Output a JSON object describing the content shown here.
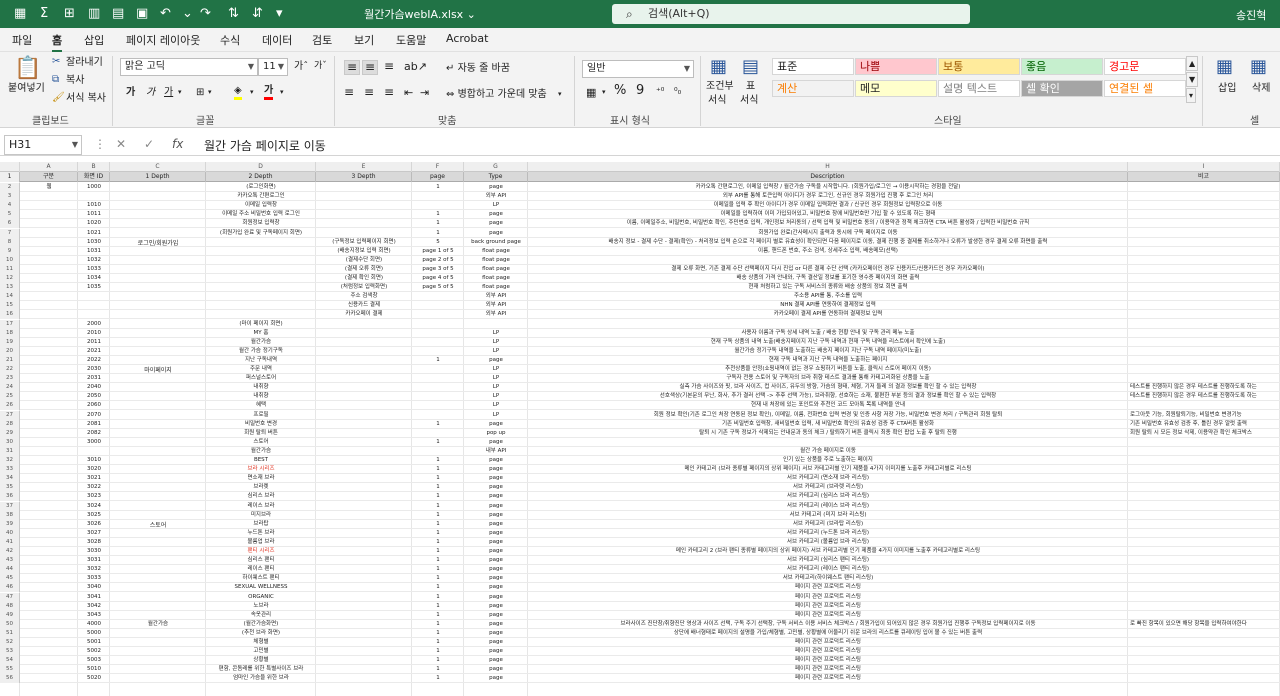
{
  "titlebar": {
    "filename": "월간가슴webIA.xlsx ⌄",
    "search": "검색(Alt+Q)",
    "user": "송진혁"
  },
  "menu": [
    "파일",
    "홈",
    "삽입",
    "페이지 레이아웃",
    "수식",
    "데이터",
    "검토",
    "보기",
    "도움말",
    "Acrobat"
  ],
  "ribbon": {
    "paste": "붙여넣기",
    "cut": "잘라내기",
    "copy": "복사",
    "format_painter": "서식 복사",
    "clipboard": "클립보드",
    "font_name": "맑은 고딕",
    "font_size": "11",
    "font_group": "글꼴",
    "wrap": "자동 줄 바꿈",
    "merge": "병합하고 가운데 맞춤",
    "align_group": "맞춤",
    "num_format": "일반",
    "num_group": "표시 형식",
    "cond_format": "조건부",
    "cond_format2": "서식",
    "table_format": "표",
    "table_format2": "서식",
    "styles": [
      {
        "label": "표준",
        "bg": "#ffffff",
        "color": "#222"
      },
      {
        "label": "나쁨",
        "bg": "#ffc7ce",
        "color": "#9c0006"
      },
      {
        "label": "보통",
        "bg": "#ffeb9c",
        "color": "#9c5700"
      },
      {
        "label": "좋음",
        "bg": "#c6efce",
        "color": "#006100"
      },
      {
        "label": "경고문",
        "bg": "#ffffff",
        "color": "#ff0000"
      },
      {
        "label": "계산",
        "bg": "#f2f2f2",
        "color": "#fa7d00"
      },
      {
        "label": "메모",
        "bg": "#ffffcc",
        "color": "#222"
      },
      {
        "label": "설명 텍스트",
        "bg": "#ffffff",
        "color": "#7f7f7f"
      },
      {
        "label": "셀 확인",
        "bg": "#a5a5a5",
        "color": "#ffffff"
      },
      {
        "label": "연결된 셀",
        "bg": "#ffffff",
        "color": "#fa7d00"
      }
    ],
    "style_group": "스타일",
    "insert": "삽입",
    "delete": "삭제",
    "cells_group": "셀"
  },
  "formula": {
    "cellref": "H31",
    "fx": "fx",
    "content": "월간 가슴 페이지로 이동"
  },
  "colletters": [
    "A",
    "B",
    "C",
    "D",
    "E",
    "F",
    "G",
    "H",
    "I"
  ],
  "headers": [
    "구분",
    "화면 ID",
    "1 Depth",
    "2 Depth",
    "3 Depth",
    "page",
    "Type",
    "Description",
    "비고"
  ],
  "rows": [
    {
      "n": "2",
      "a": "웹",
      "b": "1000",
      "c": "",
      "d": "(로그인화면)",
      "e": "",
      "f": "1",
      "g": "page",
      "h": "카카오톡 간편로그인, 이메일 입력창 / 월간가슴 구독을 시작합니다. (회원가입/로그인 → 이용시작하는 경험을 전달)",
      "i": ""
    },
    {
      "n": "3",
      "a": "",
      "b": "",
      "c": "",
      "d": "카카오톡 간편로그인",
      "e": "",
      "f": "",
      "g": "외부 API",
      "h": "외부 API를 통해 토큰입력 아이디가 경우 로그인, 신규인 경우 회원가입 진행 후 로그인 처리",
      "i": ""
    },
    {
      "n": "4",
      "a": "",
      "b": "1010",
      "c": "",
      "d": "이메일 입력창",
      "e": "",
      "f": "",
      "g": "LP",
      "h": "이메일을 입력 후 확인 아이디가 경우 이메일 입력화면 결과 / 신규인 경우 회원정보 입력창으로 이동",
      "i": ""
    },
    {
      "n": "5",
      "a": "",
      "b": "1011",
      "c": "",
      "d": "이메일 주소 비밀번호 입력 로그인",
      "e": "",
      "f": "1",
      "g": "page",
      "h": "이메일을 입력하여 이미 가입되어있고, 비밀번호 창에 비밀번호만 기입 할 수 있도록 하는 형태",
      "i": ""
    },
    {
      "n": "6",
      "a": "",
      "b": "1020",
      "c": "",
      "d": "회원정보 입력창",
      "e": "",
      "f": "1",
      "g": "page",
      "h": "이름, 이메일주소, 비밀번호, 비밀번호 확인, 주민번호 입력, 개인정보 처리동의 / 선택 입력 및 비밀번호 동의 / 이용약관 정책 체크하면 CTA 버튼 활성화 / 입력한 비밀번호 규칙",
      "i": ""
    },
    {
      "n": "7",
      "a": "",
      "b": "1021",
      "c": "",
      "d": "(회원가입 완료 및 구독페이지 회면)",
      "e": "",
      "f": "1",
      "g": "page",
      "h": "회원가입 완료(간사메시지 출력과 동시에 구독 페이지로 이동",
      "i": ""
    },
    {
      "n": "8",
      "a": "",
      "b": "1030",
      "c": "",
      "d": "",
      "e": "(구독정보 입력페이지 회면)",
      "f": "5",
      "g": "back ground page",
      "h": "배송지 정보 - 결제 수단 - 결제(확인) - 처리정보 입력 순으로 각 페이지 별로 유효성이 확인되면 다음 페이지로 이동, 결제 진행 중 결제를 취소하거나 오류가 발생한 경우 결제 오류 화면을 출력",
      "i": ""
    },
    {
      "n": "9",
      "a": "",
      "b": "1031",
      "c": "",
      "d": "",
      "e": "(배송지정보 입력 회면)",
      "f": "page 1 of 5",
      "g": "float page",
      "h": "이름, 핸드폰 번호, 주소 검색, 상세주소 입력, 배송메모(선택)",
      "i": ""
    },
    {
      "n": "10",
      "a": "",
      "b": "1032",
      "c": "",
      "d": "",
      "e": "(결제수단 회면)",
      "f": "page 2 of 5",
      "g": "float page",
      "h": "",
      "i": ""
    },
    {
      "n": "11",
      "a": "",
      "b": "1033",
      "c": "",
      "d": "",
      "e": "(결제 오류 회면)",
      "f": "page 3 of 5",
      "g": "float page",
      "h": "결제 오류 화면, 기존 결제 수단 선택페이지 다시 진입 or 다른 결제 수단 선택 (카카오페이인 경우 신용카드/신용카드인 경우 카카오페이)",
      "i": ""
    },
    {
      "n": "12",
      "a": "",
      "b": "1034",
      "c": "",
      "d": "",
      "e": "(결제 확인 회면)",
      "f": "page 4 of 5",
      "g": "float page",
      "h": "배송 상품의 가격 안내와, 구독 결산일 정보를 표기한 영수증 페이지의 화면 출력",
      "i": ""
    },
    {
      "n": "13",
      "a": "",
      "b": "1035",
      "c": "",
      "d": "",
      "e": "(처럼정보 입력화면)",
      "f": "page 5 of 5",
      "g": "float page",
      "h": "현재 처럼하고 있는 구독 서비스의 종류와 배송 상품의 정보 회면 출력",
      "i": ""
    },
    {
      "n": "14",
      "a": "",
      "b": "",
      "c": "",
      "d": "",
      "e": "주소 검색창",
      "f": "",
      "g": "외부 API",
      "h": "주소용 API를 통, 주소를 입력",
      "i": ""
    },
    {
      "n": "15",
      "a": "",
      "b": "",
      "c": "",
      "d": "",
      "e": "신용카드 결제",
      "f": "",
      "g": "외부 API",
      "h": "NHN 결제 API를 연동하여 결제정보 입력",
      "i": ""
    },
    {
      "n": "16",
      "a": "",
      "b": "",
      "c": "",
      "d": "",
      "e": "카카오페이 결제",
      "f": "",
      "g": "외부 API",
      "h": "카카오페이 결제 API를 연동하여 결제정보 입력",
      "i": ""
    },
    {
      "n": "17",
      "a": "",
      "b": "2000",
      "c": "",
      "d": "(마이 페이지 회면)",
      "e": "",
      "f": "",
      "g": "",
      "h": "",
      "i": ""
    },
    {
      "n": "18",
      "a": "",
      "b": "2010",
      "c": "",
      "d": "MY 홈",
      "e": "",
      "f": "",
      "g": "LP",
      "h": "사용자 이름과 구독 상세 내역 노출 / 배송 현황 안내 및 구독 관리 메뉴 노출",
      "i": ""
    },
    {
      "n": "19",
      "a": "",
      "b": "2011",
      "c": "",
      "d": "월간가슴",
      "e": "",
      "f": "",
      "g": "LP",
      "h": "현재 구독 상품의 내역 노출(배송지페이지 지난 구독 내역과 현재 구독 내역을 리스트에서 확인에 노출)",
      "i": ""
    },
    {
      "n": "20",
      "a": "",
      "b": "2021",
      "c": "",
      "d": "월간 가슴 정기구독",
      "e": "",
      "f": "",
      "g": "LP",
      "h": "월간가슴 정기구독 내역을 노출하는 배송지 페이지 지난 구독 내역 페이지(미노출)",
      "i": ""
    },
    {
      "n": "21",
      "a": "",
      "b": "2022",
      "c": "",
      "d": "지난 구독내역",
      "e": "",
      "f": "1",
      "g": "page",
      "h": "현재 구독 내역과 지난 구독 내역을 노출하는 페이지",
      "i": ""
    },
    {
      "n": "22",
      "a": "",
      "b": "2030",
      "c": "",
      "d": "주문 내역",
      "e": "",
      "f": "",
      "g": "LP",
      "h": "추천상품을 안정(쇼핑내역이 없는 경우 쇼핑하기 버튼을 노출, 클릭시 스토어 페이지 이동)",
      "i": ""
    },
    {
      "n": "23",
      "a": "",
      "b": "2031",
      "c": "",
      "d": "퍼스널스토어",
      "e": "",
      "f": "",
      "g": "LP",
      "h": "구독자 전용 스토어 및 구독자의 브라 취향 테스트 결과를 통해 카테고리화된 상품을 노출",
      "i": ""
    },
    {
      "n": "24",
      "a": "",
      "b": "2040",
      "c": "",
      "d": "내취향",
      "e": "",
      "f": "",
      "g": "LP",
      "h": "실측 가슴 사이즈와 핏, 브라 사이즈, 컵 사이즈, 유두의 방향, 가슴의 형태, 체형, 기저 둘레 의 결과 정보를 확인 할 수 있는 입력창",
      "i": "테스트를 진행하지 않은 경우 테스트를 진행하도록 하는"
    },
    {
      "n": "25",
      "a": "",
      "b": "2050",
      "c": "",
      "d": "내취향",
      "e": "",
      "f": "",
      "g": "LP",
      "h": "선호색상(기본문의 무난, 화사, 추가 결러 선택 -> 추후 선택 가능), 브라취향, 선호하는 소재, 불편한 부분 등의 결과 정보를 확인 할 수 있는 입력창",
      "i": "테스트를 진행하지 않은 경우 테스트를 진행하도록 하는"
    },
    {
      "n": "26",
      "a": "",
      "b": "2060",
      "c": "",
      "d": "혜택",
      "e": "",
      "f": "",
      "g": "LP",
      "h": "현재 내 처장에 있는 포인트와 추천인 코드 모아톡 목록 내역을 안내",
      "i": ""
    },
    {
      "n": "27",
      "a": "",
      "b": "2070",
      "c": "",
      "d": "프로필",
      "e": "",
      "f": "",
      "g": "LP",
      "h": "회원 정보 확인(기존 로그인 처장 연동된 정보 확인), 이메일, 이름, 전화번호 입력 변경 및 인증 사항 저장 가능, 비밀번호 변경 처리 / 구독관리 회원 탈퇴",
      "i": "로그아웃 기능, 회원탈퇴기능, 비밀번호 변경기능"
    },
    {
      "n": "28",
      "a": "",
      "b": "2081",
      "c": "",
      "d": "비밀번호 변경",
      "e": "",
      "f": "1",
      "g": "page",
      "h": "기존 비밀번호 입력창, 새비밀번호 입력, 새 비밀번호 확인의 유효성 검증 후 CTA버튼 활성화",
      "i": "기존 비밀번호 유효성 검증 후, 틀린 경우 알럿 출력"
    },
    {
      "n": "29",
      "a": "",
      "b": "2082",
      "c": "",
      "d": "회원 탈퇴 버튼",
      "e": "",
      "f": "",
      "g": "pop up",
      "h": "탈퇴 시 기존 구독 정보가 삭제되는 안내문과 동의 체크 / 탈퇴하기 버튼 클릭시 최종 확인 팝업 노출 후 탈퇴 진행",
      "i": "회원 탈퇴 시 모든 정보 삭제, 이용약관 확인 체크박스"
    },
    {
      "n": "30",
      "a": "",
      "b": "3000",
      "c": "",
      "d": "스토어",
      "e": "",
      "f": "1",
      "g": "page",
      "h": "",
      "i": ""
    },
    {
      "n": "31",
      "a": "",
      "b": "",
      "c": "",
      "d": "월간가슴",
      "e": "",
      "f": "",
      "g": "내부 API",
      "h": "월간 가슴 페이지로 이동",
      "i": ""
    },
    {
      "n": "32",
      "a": "",
      "b": "3010",
      "c": "",
      "d": "BEST",
      "e": "",
      "f": "1",
      "g": "page",
      "h": "인기 있는 상품을 주로 노출하는 페이지",
      "i": ""
    },
    {
      "n": "33",
      "a": "",
      "b": "3020",
      "c": "",
      "d": "브라 시리즈",
      "e": "",
      "f": "1",
      "g": "page",
      "h": "메인 카테고리 (브라 종류별 페이지의 상위 페이지) 서브 카테고리별 인기 제품을 4가지 이미지를 노출후 카테고리별로 리스팅",
      "i": "",
      "red": true
    },
    {
      "n": "34",
      "a": "",
      "b": "3021",
      "c": "",
      "d": "면소재 브라",
      "e": "",
      "f": "1",
      "g": "page",
      "h": "서브 카테고리 (면소재 브라 리스팅)",
      "i": ""
    },
    {
      "n": "35",
      "a": "",
      "b": "3022",
      "c": "",
      "d": "브라렛",
      "e": "",
      "f": "1",
      "g": "page",
      "h": "서브 카테고리 (브라렛 리스팅)",
      "i": ""
    },
    {
      "n": "36",
      "a": "",
      "b": "3023",
      "c": "",
      "d": "심리스 브라",
      "e": "",
      "f": "1",
      "g": "page",
      "h": "서브 카테고리 (심리스 브라 리스팅)",
      "i": ""
    },
    {
      "n": "37",
      "a": "",
      "b": "3024",
      "c": "",
      "d": "레이스 브라",
      "e": "",
      "f": "1",
      "g": "page",
      "h": "서브 카테고리 (레이스 브라 리스팅)",
      "i": ""
    },
    {
      "n": "38",
      "a": "",
      "b": "3025",
      "c": "",
      "d": "미지브라",
      "e": "",
      "f": "1",
      "g": "page",
      "h": "서브 카테고리 (미지 브라 리스팅)",
      "i": ""
    },
    {
      "n": "39",
      "a": "",
      "b": "3026",
      "c": "",
      "d": "브라탑",
      "e": "",
      "f": "1",
      "g": "page",
      "h": "서브 카테고리 (브라탑 리스팅)",
      "i": ""
    },
    {
      "n": "40",
      "a": "",
      "b": "3027",
      "c": "",
      "d": "누드톤 브라",
      "e": "",
      "f": "1",
      "g": "page",
      "h": "서브 카테고리 (누드톤 브라 리스팅)",
      "i": ""
    },
    {
      "n": "41",
      "a": "",
      "b": "3028",
      "c": "",
      "d": "볼륨업 브라",
      "e": "",
      "f": "1",
      "g": "page",
      "h": "서브 카테고리 (볼륨업 브라 리스팅)",
      "i": ""
    },
    {
      "n": "42",
      "a": "",
      "b": "3030",
      "c": "",
      "d": "팬티 시리즈",
      "e": "",
      "f": "1",
      "g": "page",
      "h": "메인 카테고리 2 (브라 팬티 종류별 페이지의 상위 페이지) 서브 카테고리별 인기 제품을 4가지 이미지를 노출후 카테고리별로 리스팅",
      "i": "",
      "red": true
    },
    {
      "n": "43",
      "a": "",
      "b": "3031",
      "c": "",
      "d": "심리스 팬티",
      "e": "",
      "f": "1",
      "g": "page",
      "h": "서브 카테고리 (심리스 팬티 리스팅)",
      "i": ""
    },
    {
      "n": "44",
      "a": "",
      "b": "3032",
      "c": "",
      "d": "레이스 팬티",
      "e": "",
      "f": "1",
      "g": "page",
      "h": "서브 카테고리 (레이스 팬티 리스팅)",
      "i": ""
    },
    {
      "n": "45",
      "a": "",
      "b": "3033",
      "c": "",
      "d": "하이웨스트 팬티",
      "e": "",
      "f": "1",
      "g": "page",
      "h": "서브 카테고리(하이웨스트 팬티 리스팅)",
      "i": ""
    },
    {
      "n": "46",
      "a": "",
      "b": "3040",
      "c": "",
      "d": "SEXUAL WELLNESS",
      "e": "",
      "f": "1",
      "g": "page",
      "h": "페이지 관련 프로덕트 리스팅",
      "i": ""
    },
    {
      "n": "47",
      "a": "",
      "b": "3041",
      "c": "",
      "d": "ORGANIC",
      "e": "",
      "f": "1",
      "g": "page",
      "h": "페이지 관련 프로덕트 리스팅",
      "i": ""
    },
    {
      "n": "48",
      "a": "",
      "b": "3042",
      "c": "",
      "d": "노브라",
      "e": "",
      "f": "1",
      "g": "page",
      "h": "페이지 관련 프로덕트 리스팅",
      "i": ""
    },
    {
      "n": "49",
      "a": "",
      "b": "3043",
      "c": "",
      "d": "속옷관리",
      "e": "",
      "f": "1",
      "g": "page",
      "h": "페이지 관련 프로덕트 리스팅",
      "i": ""
    },
    {
      "n": "50",
      "a": "",
      "b": "4000",
      "c": "월간가슴",
      "d": "(월간가슴화면)",
      "e": "",
      "f": "1",
      "g": "page",
      "h": "브라사이즈 진단창/취향진단 영상과 사이즈 선택, 구독 주기 선택창, 구독 서비스 이용 서비스 체크박스 / 회원가입이 되어있지 않은 경우 회원가입 진행후 구독정보 입력페이지로 이동",
      "i": "로 빠진 항목이 있으면 해당 항목을 입력하여야한다"
    },
    {
      "n": "51",
      "a": "",
      "b": "5000",
      "c": "",
      "d": "(추천 브라 화면)",
      "e": "",
      "f": "1",
      "g": "page",
      "h": "상단에 배너형태로 페이지의 설명을 가입/체형별, 고민별, 상황별에 어울리기 쉬운 브라의 리스트를 큐레이팅 입어 볼 수 있는 버튼 출력",
      "i": ""
    },
    {
      "n": "52",
      "a": "",
      "b": "5001",
      "c": "",
      "d": "체형별",
      "e": "",
      "f": "1",
      "g": "page",
      "h": "페이지 관련 프로덕트 리스팅",
      "i": ""
    },
    {
      "n": "53",
      "a": "",
      "b": "5002",
      "c": "",
      "d": "고민별",
      "e": "",
      "f": "1",
      "g": "page",
      "h": "페이지 관련 프로덕트 리스팅",
      "i": ""
    },
    {
      "n": "54",
      "a": "",
      "b": "5003",
      "c": "",
      "d": "상황별",
      "e": "",
      "f": "1",
      "g": "page",
      "h": "페이지 관련 프로덕트 리스팅",
      "i": ""
    },
    {
      "n": "55",
      "a": "",
      "b": "5010",
      "c": "",
      "d": "편함, 콘돔레를 위한 특별사이즈 브라",
      "e": "",
      "f": "1",
      "g": "page",
      "h": "페이지 관련 프로덕트 리스팅",
      "i": ""
    },
    {
      "n": "56",
      "a": "",
      "b": "5020",
      "c": "",
      "d": "엄마인 가슴을 위한 브라",
      "e": "",
      "f": "1",
      "g": "page",
      "h": "페이지 관련 프로덕트 리스팅",
      "i": ""
    }
  ],
  "groups": [
    {
      "label": "로그인/회원가입",
      "row": 8
    },
    {
      "label": "마이페이지",
      "row": 22
    },
    {
      "label": "스토어",
      "row": 39
    }
  ]
}
